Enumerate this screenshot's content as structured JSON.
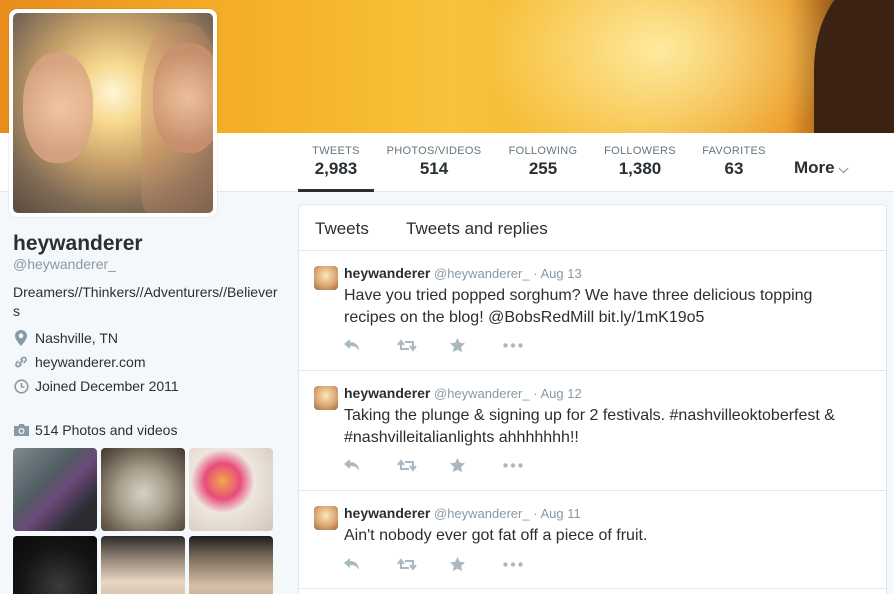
{
  "profile": {
    "name": "heywanderer",
    "handle": "@heywanderer_",
    "bio": "Dreamers//Thinkers//Adventurers//Believers",
    "location": "Nashville, TN",
    "website": "heywanderer.com",
    "joined": "Joined December 2011",
    "photos_label": "514 Photos and videos"
  },
  "nav": {
    "stats": [
      {
        "label": "TWEETS",
        "value": "2,983"
      },
      {
        "label": "PHOTOS/VIDEOS",
        "value": "514"
      },
      {
        "label": "FOLLOWING",
        "value": "255"
      },
      {
        "label": "FOLLOWERS",
        "value": "1,380"
      },
      {
        "label": "FAVORITES",
        "value": "63"
      }
    ],
    "more_label": "More"
  },
  "stream": {
    "tabs": [
      "Tweets",
      "Tweets and replies"
    ],
    "tweets": [
      {
        "name": "heywanderer",
        "handle": "@heywanderer_",
        "sep": "·",
        "date": "Aug 13",
        "text": "Have you tried popped sorghum? We have three delicious topping recipes on the blog! @BobsRedMill bit.ly/1mK19o5"
      },
      {
        "name": "heywanderer",
        "handle": "@heywanderer_",
        "sep": "·",
        "date": "Aug 12",
        "text": "Taking the plunge & signing up for 2 festivals. #nashvilleoktoberfest & #nashvilleitalianlights  ahhhhhhh!!"
      },
      {
        "name": "heywanderer",
        "handle": "@heywanderer_",
        "sep": "·",
        "date": "Aug 11",
        "text": "Ain't nobody ever got fat off a piece of fruit."
      }
    ]
  },
  "icons": {
    "reply": "reply-icon",
    "retweet": "retweet-icon",
    "favorite": "star-icon",
    "more": "more-dots-icon",
    "location": "map-pin-icon",
    "link": "link-icon",
    "calendar": "clock-icon",
    "camera": "camera-icon"
  },
  "colors": {
    "text": "#292f33",
    "muted": "#8899a6",
    "action": "#aab8c2",
    "border": "#e1e8ed"
  }
}
